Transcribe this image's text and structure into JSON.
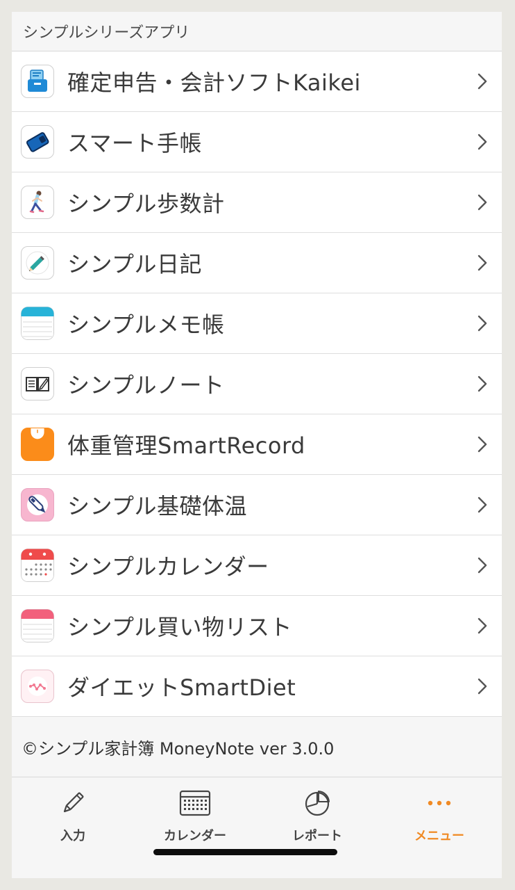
{
  "section_header": "シンプルシリーズアプリ",
  "apps": [
    {
      "label": "確定申告・会計ソフトKaikei",
      "icon": "accounting-icon"
    },
    {
      "label": "スマート手帳",
      "icon": "notebook-planner-icon"
    },
    {
      "label": "シンプル歩数計",
      "icon": "pedometer-walker-icon"
    },
    {
      "label": "シンプル日記",
      "icon": "diary-pencil-icon"
    },
    {
      "label": "シンプルメモ帳",
      "icon": "memo-pad-icon"
    },
    {
      "label": "シンプルノート",
      "icon": "note-book-icon"
    },
    {
      "label": "体重管理SmartRecord",
      "icon": "weight-scale-icon"
    },
    {
      "label": "シンプル基礎体温",
      "icon": "thermometer-icon"
    },
    {
      "label": "シンプルカレンダー",
      "icon": "calendar-app-icon"
    },
    {
      "label": "シンプル買い物リスト",
      "icon": "shopping-list-icon"
    },
    {
      "label": "ダイエットSmartDiet",
      "icon": "diet-graph-icon"
    }
  ],
  "footer": "©シンプル家計簿 MoneyNote ver 3.0.0",
  "tabbar": {
    "tabs": [
      {
        "label": "入力",
        "icon": "pencil-icon"
      },
      {
        "label": "カレンダー",
        "icon": "calendar-icon"
      },
      {
        "label": "レポート",
        "icon": "pie-chart-icon"
      },
      {
        "label": "メニュー",
        "icon": "more-dots-icon"
      }
    ],
    "active_index": 3,
    "accent_color": "#f08a24"
  }
}
